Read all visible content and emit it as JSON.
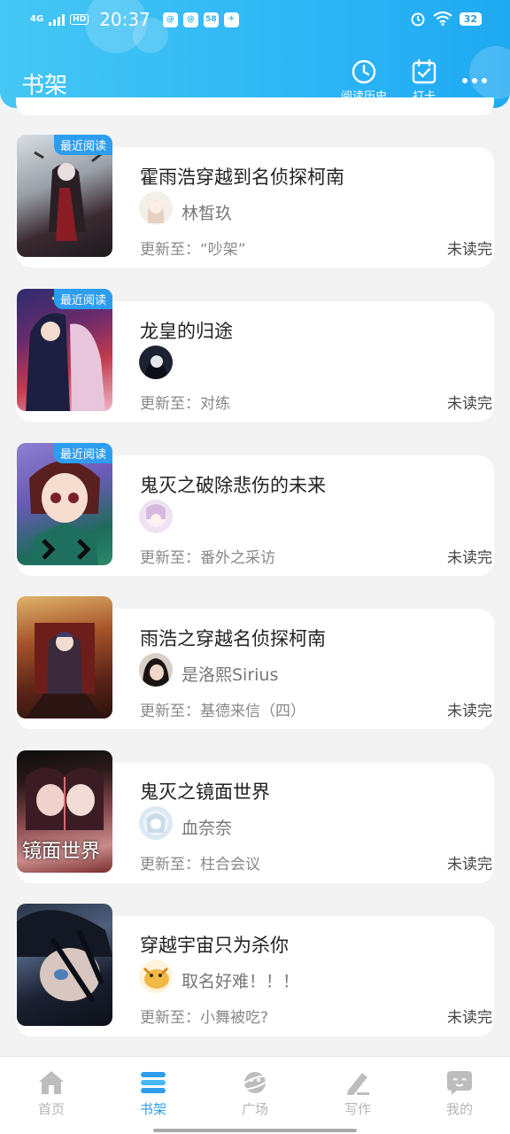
{
  "status_bar": {
    "network": "4G",
    "hd_label": "HD",
    "time": "20:37",
    "app_icons": [
      "@",
      "@",
      "58",
      "✈"
    ],
    "battery": "32"
  },
  "header": {
    "title": "书架",
    "history_label": "阅读历史",
    "checkin_label": "打卡"
  },
  "books": [
    {
      "title": "霍雨浩穿越到名侦探柯南",
      "author": "林皙玖",
      "update": "更新至：“吵架”",
      "status": "未读完",
      "badge": "最近阅读"
    },
    {
      "title": "龙皇的归途",
      "author": "",
      "update": "更新至：对练",
      "status": "未读完",
      "badge": "最近阅读"
    },
    {
      "title": "鬼灭之破除悲伤的未来",
      "author": "",
      "update": "更新至：番外之采访",
      "status": "未读完",
      "badge": "最近阅读"
    },
    {
      "title": "雨浩之穿越名侦探柯南",
      "author": "是洛熙Sirius",
      "update": "更新至：基德来信（四）",
      "status": "未读完",
      "badge": ""
    },
    {
      "title": "鬼灭之镜面世界",
      "author": "血奈奈",
      "update": "更新至：柱合会议",
      "status": "未读完",
      "badge": "",
      "cover_text": "镜面世界"
    },
    {
      "title": "穿越宇宙只为杀你",
      "author": "取名好难！！！",
      "update": "更新至：小舞被吃?",
      "status": "未读完",
      "badge": ""
    }
  ],
  "nav": [
    {
      "label": "首页",
      "icon": "home-icon"
    },
    {
      "label": "书架",
      "icon": "bookshelf-icon"
    },
    {
      "label": "广场",
      "icon": "planet-icon"
    },
    {
      "label": "写作",
      "icon": "pen-icon"
    },
    {
      "label": "我的",
      "icon": "chat-face-icon"
    }
  ],
  "colors": {
    "accent": "#2d9df0",
    "header": "#2db6f5",
    "inactive": "#b5b5b5"
  }
}
